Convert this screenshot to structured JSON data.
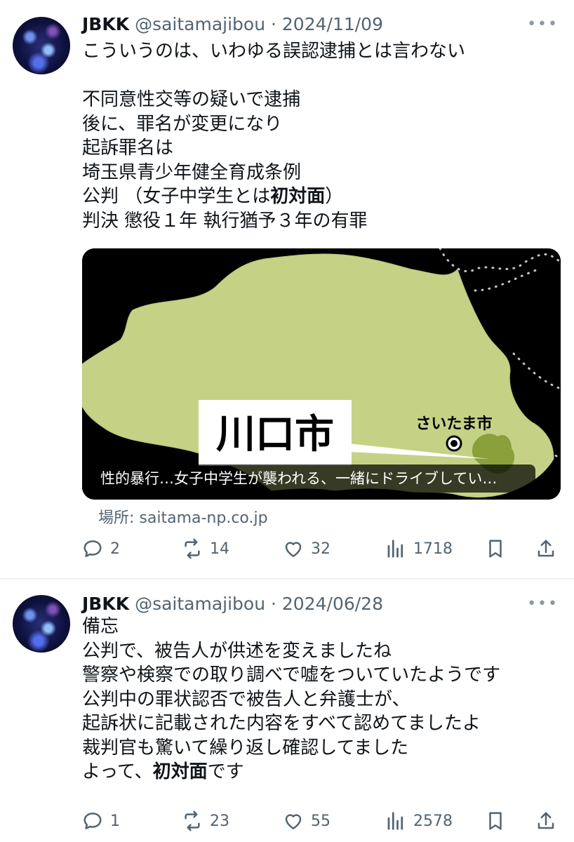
{
  "tweets": [
    {
      "name": "JBKK",
      "handle": "@saitamajibou",
      "date": "2024/11/09",
      "more": "•••",
      "text_lines": [
        "こういうのは、いわゆる誤認逮捕とは言わない",
        "",
        "不同意性交等の疑いで逮捕",
        "後に、罪名が変更になり",
        "起訴罪名は",
        "埼玉県青少年健全育成条例",
        "公判 （女子中学生とは",
        "判決 懲役１年 執行猶予３年の有罪"
      ],
      "bold_fragment": "初対面",
      "line7_suffix": "）",
      "card": {
        "map_label_big": "川口市",
        "map_label_small": "さいたま市",
        "caption": "性的暴行…女子中学生が襲われる、一緒にドライブしてい…",
        "source": "場所: saitama-np.co.jp"
      },
      "replies": "2",
      "retweets": "14",
      "likes": "32",
      "views": "1718"
    },
    {
      "name": "JBKK",
      "handle": "@saitamajibou",
      "date": "2024/06/28",
      "more": "•••",
      "text_lines": [
        "備忘",
        "公判で、被告人が供述を変えましたね",
        "警察や検察での取り調べで嘘をついていたようです",
        "公判中の罪状認否で被告人と弁護士が、",
        "起訴状に記載された内容をすべて認めてましたよ",
        "裁判官も驚いて繰り返し確認してました",
        "よって、"
      ],
      "bold_fragment": "初対面",
      "last_suffix": "です",
      "replies": "1",
      "retweets": "23",
      "likes": "55",
      "views": "2578"
    }
  ],
  "colors": {
    "text": "#0f1419",
    "muted": "#536471",
    "map_land": "#c5d286",
    "map_city": "#8aa03a",
    "separator": "#eff3f4"
  },
  "icons": [
    "reply-icon",
    "retweet-icon",
    "like-icon",
    "views-icon",
    "bookmark-icon",
    "share-icon",
    "more-icon",
    "city-marker-icon"
  ]
}
